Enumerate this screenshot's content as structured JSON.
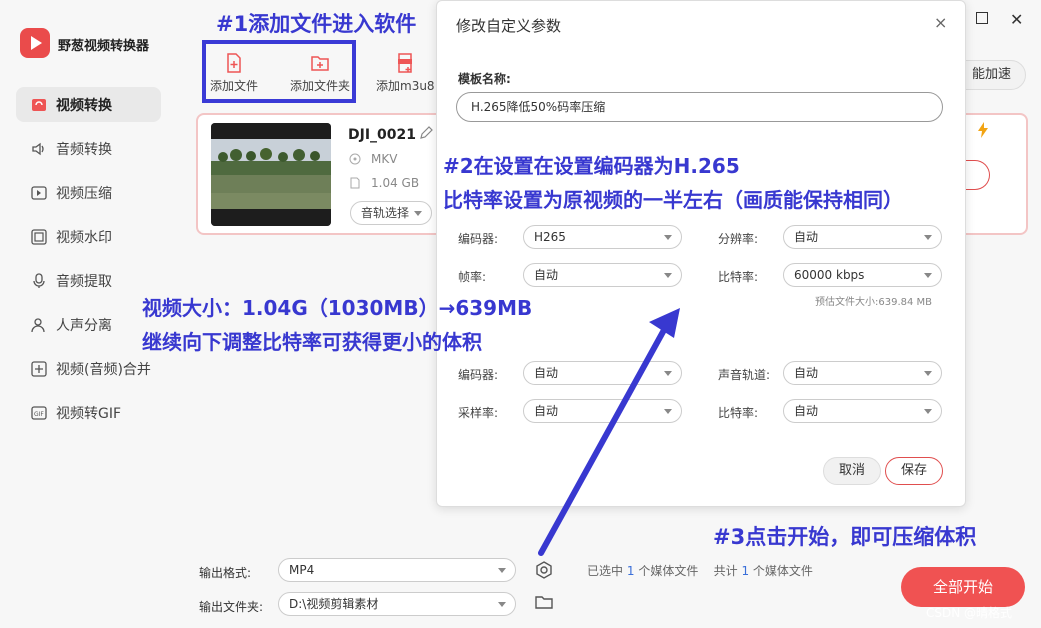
{
  "app": {
    "name": "野葱视频转换器"
  },
  "sidebar": {
    "items": [
      {
        "label": "视频转换",
        "icon": "video-convert-icon"
      },
      {
        "label": "音频转换",
        "icon": "audio-convert-icon"
      },
      {
        "label": "视频压缩",
        "icon": "video-compress-icon"
      },
      {
        "label": "视频水印",
        "icon": "video-watermark-icon"
      },
      {
        "label": "音频提取",
        "icon": "audio-extract-icon"
      },
      {
        "label": "人声分离",
        "icon": "vocal-separate-icon"
      },
      {
        "label": "视频(音频)合并",
        "icon": "merge-icon"
      },
      {
        "label": "视频转GIF",
        "icon": "gif-icon"
      }
    ]
  },
  "toolbar": {
    "add_file": "添加文件",
    "add_folder": "添加文件夹",
    "add_m3u8": "添加m3u8",
    "speed": "能加速"
  },
  "file": {
    "name": "DJI_0021",
    "format": "MKV",
    "size": "1.04 GB",
    "track": "音轨选择"
  },
  "dialog": {
    "title": "修改自定义参数",
    "template_label": "模板名称:",
    "template_value": "H.265降低50%码率压缩",
    "video": {
      "encoder_label": "编码器:",
      "encoder_value": "H265",
      "resolution_label": "分辨率:",
      "resolution_value": "自动",
      "framerate_label": "帧率:",
      "framerate_value": "自动",
      "bitrate_label": "比特率:",
      "bitrate_value": "60000 kbps",
      "estimate": "预估文件大小:639.84 MB"
    },
    "audio": {
      "encoder_label": "编码器:",
      "encoder_value": "自动",
      "track_label": "声音轨道:",
      "track_value": "自动",
      "samplerate_label": "采样率:",
      "samplerate_value": "自动",
      "bitrate_label": "比特率:",
      "bitrate_value": "自动"
    },
    "cancel": "取消",
    "save": "保存",
    "close": "×"
  },
  "bottom": {
    "format_label": "输出格式:",
    "format_value": "MP4",
    "folder_label": "输出文件夹:",
    "folder_value": "D:\\视频剪辑素材",
    "selected_prefix": "已选中",
    "selected_count": "1",
    "selected_suffix": "个媒体文件",
    "total_prefix": "共计",
    "total_count": "1",
    "total_suffix": "个媒体文件",
    "start": "全部开始"
  },
  "annotations": {
    "a1": "#1添加文件进入软件",
    "a2_line1": "#2在设置在设置编码器为H.265",
    "a2_line2": "比特率设置为原视频的一半左右（画质能保持相同）",
    "size_line1": "视频大小：1.04G（1030MB）→639MB",
    "size_line2": "继续向下调整比特率可获得更小的体积",
    "a3": "#3点击开始，即可压缩体积",
    "color": "#3838d0"
  },
  "watermark": "CSDN @晴格式"
}
